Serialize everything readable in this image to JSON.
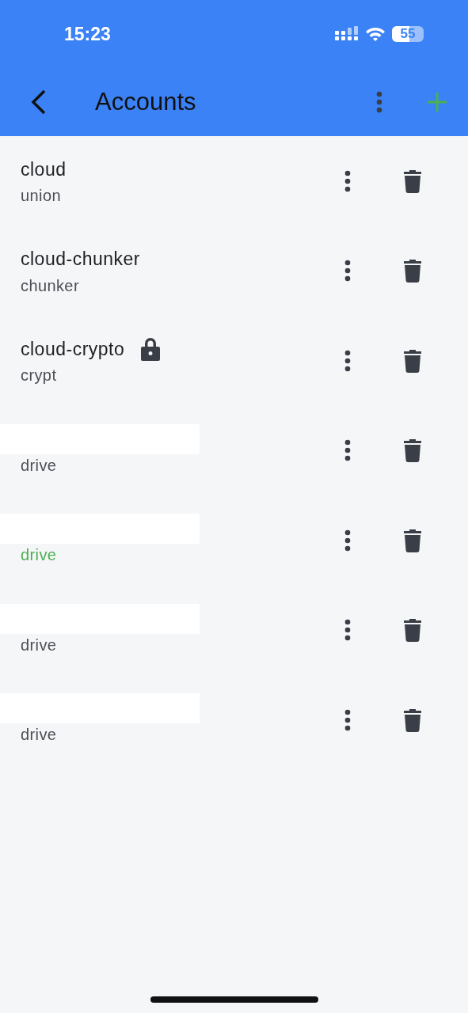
{
  "status_bar": {
    "time": "15:23",
    "battery": "55"
  },
  "header": {
    "title": "Accounts"
  },
  "accounts": [
    {
      "name": "cloud",
      "type": "union",
      "redacted": false,
      "locked": false,
      "active": false
    },
    {
      "name": "cloud-chunker",
      "type": "chunker",
      "redacted": false,
      "locked": false,
      "active": false
    },
    {
      "name": "cloud-crypto",
      "type": "crypt",
      "redacted": false,
      "locked": true,
      "active": false
    },
    {
      "type": "drive",
      "redacted": true,
      "locked": false,
      "active": false
    },
    {
      "type": "drive",
      "redacted": true,
      "locked": false,
      "active": true
    },
    {
      "type": "drive",
      "redacted": true,
      "locked": false,
      "active": false
    },
    {
      "type": "drive",
      "redacted": true,
      "locked": false,
      "active": false
    }
  ]
}
